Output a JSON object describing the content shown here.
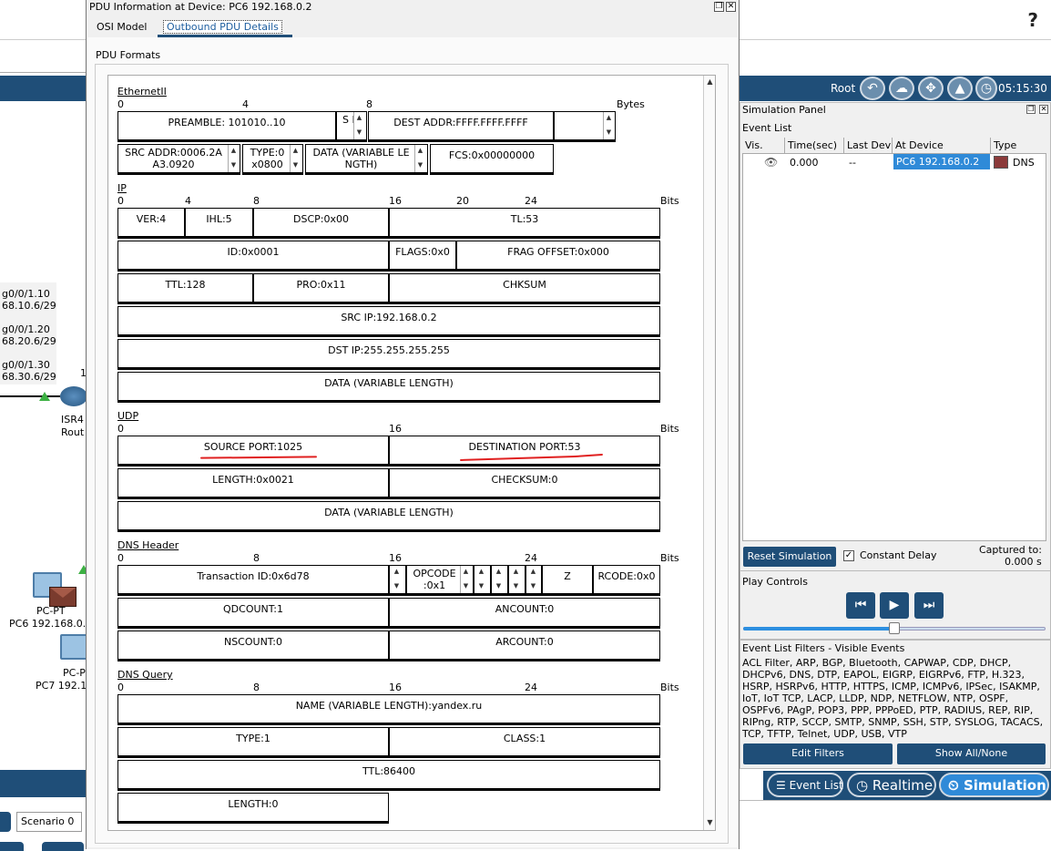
{
  "background": {
    "help_icon": "?",
    "interfaces": [
      {
        "name": "g0/0/1.10",
        "ip": "68.10.6/29"
      },
      {
        "name": "g0/0/1.20",
        "ip": "68.20.6/29"
      },
      {
        "name": "g0/0/1.30",
        "ip": "68.30.6/29"
      }
    ],
    "router_tag": "1",
    "router_name": "ISR4",
    "router_type": "Rout",
    "pc6_type": "PC-PT",
    "pc6_name": "PC6 192.168.0.",
    "pc7_type": "PC-P",
    "pc7_name": "PC7 192.1",
    "scenario": "Scenario 0"
  },
  "sim_top": {
    "root_label": "Root",
    "clock": "05:15:30"
  },
  "sim_panel": {
    "title": "Simulation Panel",
    "event_list_label": "Event List",
    "columns": [
      "Vis.",
      "Time(sec)",
      "Last Dev",
      "At Device",
      "Type"
    ],
    "events": [
      {
        "time": "0.000",
        "last_dev": "--",
        "at_device": "PC6 192.168.0.2",
        "type": "DNS",
        "color": "#8b3a3a"
      }
    ],
    "reset_button": "Reset Simulation",
    "constant_delay_label": "Constant Delay",
    "constant_delay_checked": "✓",
    "captured_label": "Captured to:",
    "captured_value": "0.000 s",
    "play_controls_label": "Play Controls",
    "filters_title": "Event List Filters - Visible Events",
    "filters_text": "ACL Filter, ARP, BGP, Bluetooth, CAPWAP, CDP, DHCP, DHCPv6, DNS, DTP, EAPOL, EIGRP, EIGRPv6, FTP, H.323, HSRP, HSRPv6, HTTP, HTTPS, ICMP, ICMPv6, IPSec, ISAKMP, IoT, IoT TCP, LACP, LLDP, NDP, NETFLOW, NTP, OSPF, OSPFv6, PAgP, POP3, PPP, PPPoED, PTP, RADIUS, REP, RIP, RIPng, RTP, SCCP, SMTP, SNMP, SSH, STP, SYSLOG, TACACS, TCP, TFTP, Telnet, UDP, USB, VTP",
    "edit_filters": "Edit Filters",
    "show_all": "Show All/None",
    "mode_event_list": "Event List",
    "mode_realtime": "Realtime",
    "mode_simulation": "Simulation",
    "speed_fraction": 0.5
  },
  "dialog": {
    "title": "PDU Information at Device: PC6 192.168.0.2",
    "tabs": [
      "OSI Model",
      "Outbound PDU Details"
    ],
    "active_tab": "Outbound PDU Details",
    "pdu_formats_label": "PDU Formats",
    "ethernet": {
      "title": "EthernetII",
      "ruler": [
        "0",
        "4",
        "8",
        "Bytes"
      ],
      "preamble": "PREAMBLE: 101010..10",
      "sfd": "S F",
      "dest": "DEST ADDR:FFFF.FFFF.FFFF",
      "src": "SRC ADDR:0006.2A A3.0920",
      "type": "TYPE:0 x0800",
      "data": "DATA (VARIABLE LE NGTH)",
      "fcs": "FCS:0x00000000"
    },
    "ip": {
      "title": "IP",
      "ruler": [
        "0",
        "4",
        "8",
        "16",
        "20",
        "24",
        "Bits"
      ],
      "ver": "VER:4",
      "ihl": "IHL:5",
      "dscp": "DSCP:0x00",
      "tl": "TL:53",
      "id": "ID:0x0001",
      "flags": "FLAGS:0x0",
      "frag": "FRAG OFFSET:0x000",
      "ttl": "TTL:128",
      "pro": "PRO:0x11",
      "chksum": "CHKSUM",
      "src": "SRC IP:192.168.0.2",
      "dst": "DST IP:255.255.255.255",
      "data": "DATA (VARIABLE LENGTH)"
    },
    "udp": {
      "title": "UDP",
      "ruler": [
        "0",
        "16",
        "Bits"
      ],
      "src_port": "SOURCE PORT:1025",
      "dst_port": "DESTINATION PORT:53",
      "length": "LENGTH:0x0021",
      "checksum": "CHECKSUM:0",
      "data": "DATA (VARIABLE LENGTH)"
    },
    "dns_header": {
      "title": "DNS Header",
      "ruler": [
        "0",
        "8",
        "16",
        "24",
        "Bits"
      ],
      "transaction": "Transaction ID:0x6d78",
      "opcode": "OPCODE :0x1",
      "z": "Z",
      "rcode": "RCODE:0x0",
      "qdcount": "QDCOUNT:1",
      "ancount": "ANCOUNT:0",
      "nscount": "NSCOUNT:0",
      "arcount": "ARCOUNT:0"
    },
    "dns_query": {
      "title": "DNS Query",
      "ruler": [
        "0",
        "8",
        "16",
        "24",
        "Bits"
      ],
      "name": "NAME (VARIABLE LENGTH):yandex.ru",
      "type": "TYPE:1",
      "class": "CLASS:1",
      "ttl": "TTL:86400",
      "length": "LENGTH:0"
    }
  }
}
